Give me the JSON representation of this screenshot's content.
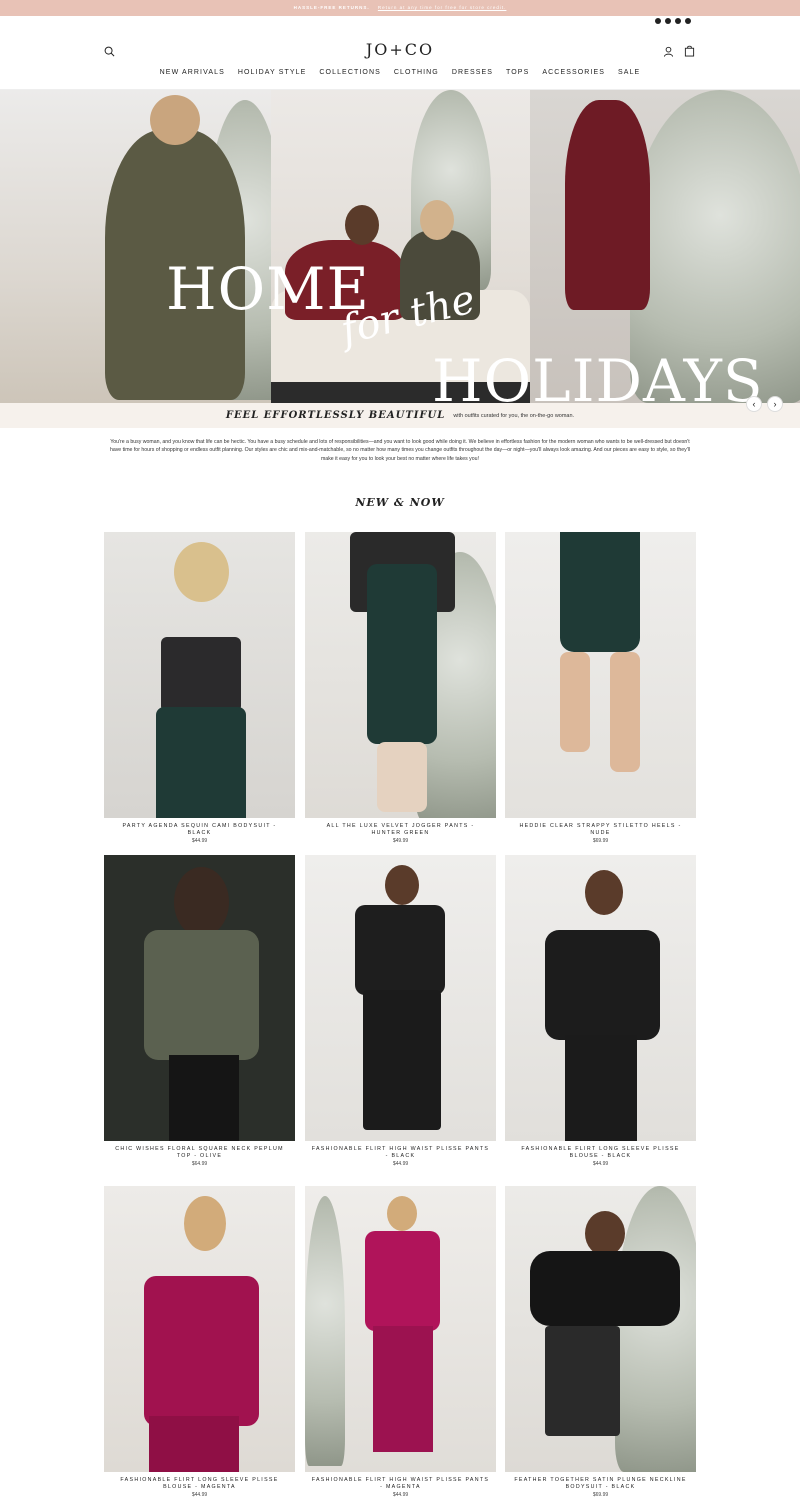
{
  "announcement": {
    "bold": "HASSLE-FREE RETURNS.",
    "link": "Return at any time for free for store credit."
  },
  "social_icons": [
    "instagram-icon",
    "facebook-icon",
    "pinterest-icon",
    "tiktok-icon"
  ],
  "header": {
    "logo": "JO+CO",
    "nav": [
      "NEW ARRIVALS",
      "HOLIDAY STYLE",
      "COLLECTIONS",
      "CLOTHING",
      "DRESSES",
      "TOPS",
      "ACCESSORIES",
      "SALE"
    ]
  },
  "hero": {
    "title_line1": "HOME",
    "title_script": "for the",
    "title_line2": "HOLIDAYS",
    "tagline": "FEEL EFFORTLESSLY BEAUTIFUL",
    "tagline_sub": "with outfits curated for you, the on-the-go woman.",
    "prev_arrow": "‹",
    "next_arrow": "›"
  },
  "intro": "You're a busy woman, and you know that life can be hectic. You have a busy schedule and lots of responsibilities—and you want to look good while doing it. We believe in effortless fashion for the modern woman who wants to be well-dressed but doesn't have time for hours of shopping or endless outfit planning. Our styles are chic and mix-and-matchable, so no matter how many times you change outfits throughout the day—or night—you'll always look amazing. And our pieces are easy to style, so they'll make it easy for you to look your best no matter where life takes you!",
  "section_title": "NEW & NOW",
  "products": [
    {
      "name": "PARTY AGENDA SEQUIN CAMI BODYSUIT - BLACK",
      "price": "$44.99"
    },
    {
      "name": "ALL THE LUXE VELVET JOGGER PANTS - HUNTER GREEN",
      "price": "$49.99"
    },
    {
      "name": "HEDDIE CLEAR STRAPPY STILETTO HEELS - NUDE",
      "price": "$69.99"
    },
    {
      "name": "CHIC WISHES FLORAL SQUARE NECK PEPLUM TOP - OLIVE",
      "price": "$64.99"
    },
    {
      "name": "FASHIONABLE FLIRT HIGH WAIST PLISSE PANTS - BLACK",
      "price": "$44.99"
    },
    {
      "name": "FASHIONABLE FLIRT LONG SLEEVE PLISSE BLOUSE - BLACK",
      "price": "$44.99"
    },
    {
      "name": "FASHIONABLE FLIRT LONG SLEEVE PLISSE BLOUSE - MAGENTA",
      "price": "$44.99"
    },
    {
      "name": "FASHIONABLE FLIRT HIGH WAIST PLISSE PANTS - MAGENTA",
      "price": "$44.99"
    },
    {
      "name": "FEATHER TOGETHER SATIN PLUNGE NECKLINE BODYSUIT - BLACK",
      "price": "$69.99"
    }
  ],
  "colors": {
    "announcement_bg": "#e8c2b6",
    "tagline_bg": "#f6f1ec",
    "text": "#222222"
  }
}
